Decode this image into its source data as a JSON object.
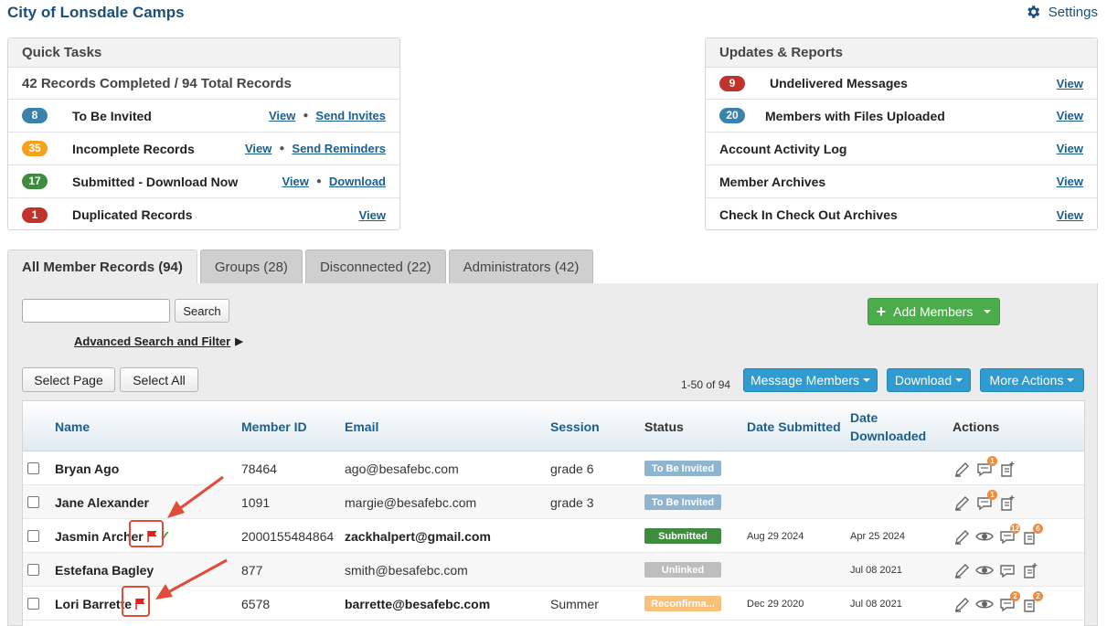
{
  "header": {
    "title": "City of Lonsdale Camps",
    "settings_label": "Settings"
  },
  "quick_tasks": {
    "title": "Quick Tasks",
    "summary": "42 Records Completed / 94 Total Records",
    "rows": [
      {
        "count": "8",
        "label": "To Be Invited",
        "link1": "View",
        "link2": "Send Invites"
      },
      {
        "count": "35",
        "label": "Incomplete Records",
        "link1": "View",
        "link2": "Send Reminders"
      },
      {
        "count": "17",
        "label": "Submitted - Download Now",
        "link1": "View",
        "link2": "Download"
      },
      {
        "count": "1",
        "label": "Duplicated Records",
        "link1": "View"
      }
    ]
  },
  "updates": {
    "title": "Updates & Reports",
    "rows": [
      {
        "count": "9",
        "label": "Undelivered Messages",
        "link": "View"
      },
      {
        "count": "20",
        "label": "Members with Files Uploaded",
        "link": "View"
      },
      {
        "label": "Account Activity Log",
        "link": "View"
      },
      {
        "label": "Member Archives",
        "link": "View"
      },
      {
        "label": "Check In Check Out Archives",
        "link": "View"
      }
    ]
  },
  "tabs": [
    {
      "label": "All Member Records (94)"
    },
    {
      "label": "Groups (28)"
    },
    {
      "label": "Disconnected (22)"
    },
    {
      "label": "Administrators (42)"
    }
  ],
  "toolbar": {
    "search_button": "Search",
    "advanced_search": "Advanced Search and Filter",
    "add_members": "Add Members",
    "select_page": "Select Page",
    "select_all": "Select All",
    "page_count": "1-50 of 94",
    "message_members": "Message Members",
    "download": "Download",
    "more_actions": "More Actions"
  },
  "table": {
    "headers": {
      "name": "Name",
      "member_id": "Member ID",
      "email": "Email",
      "session": "Session",
      "status": "Status",
      "date_submitted": "Date Submitted",
      "date_downloaded_1": "Date",
      "date_downloaded_2": "Downloaded",
      "actions": "Actions"
    },
    "rows": [
      {
        "name": "Bryan Ago",
        "member_id": "78464",
        "email": "ago@besafebc.com",
        "session": "grade 6",
        "status": "To Be Invited",
        "date_submitted": "",
        "date_downloaded": "",
        "msg_count": "1"
      },
      {
        "name": "Jane Alexander",
        "member_id": "1091",
        "email": "margie@besafebc.com",
        "session": "grade 3",
        "status": "To Be Invited",
        "date_submitted": "",
        "date_downloaded": "",
        "msg_count": "1"
      },
      {
        "name": "Jasmin Archer",
        "member_id": "2000155484864",
        "email": "zackhalpert@gmail.com",
        "session": "",
        "status": "Submitted",
        "date_submitted": "Aug 29 2024",
        "date_downloaded": "Apr 25 2024",
        "msg_count": "12",
        "file_count": "6",
        "check": "✓"
      },
      {
        "name": "Estefana Bagley",
        "member_id": "877",
        "email": "smith@besafebc.com",
        "session": "",
        "status": "Unlinked",
        "date_submitted": "",
        "date_downloaded": "Jul 08 2021"
      },
      {
        "name": "Lori Barrette",
        "member_id": "6578",
        "email": "barrette@besafebc.com",
        "session": "Summer",
        "status": "Reconfirma...",
        "date_submitted": "Dec 29 2020",
        "date_downloaded": "Jul 08 2021",
        "msg_count": "2",
        "file_count": "2"
      }
    ]
  },
  "colors": {
    "brand": "#1a4f7a",
    "link": "#1a5f8e",
    "add_green": "#4cac4c",
    "action_blue": "#2f9bd0",
    "flag_red": "#e02020",
    "annotation_red": "#e04b3a"
  }
}
